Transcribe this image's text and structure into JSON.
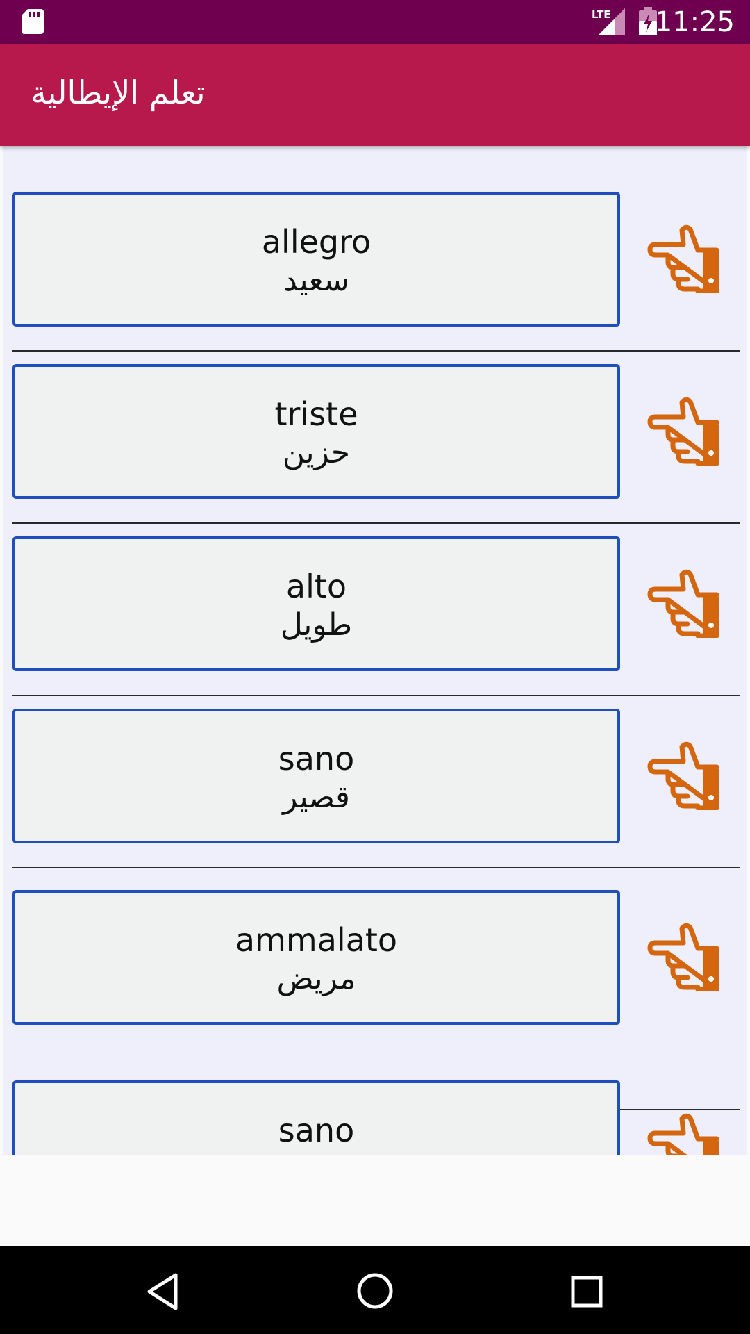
{
  "status_bar": {
    "time": "11:25",
    "network_label": "LTE",
    "icons": [
      "sd-card-icon",
      "lte-signal-icon",
      "battery-charging-icon"
    ]
  },
  "app_bar": {
    "title": "تعلم الإيطالية"
  },
  "words": [
    {
      "italian": "allegro",
      "arabic": "سعيد"
    },
    {
      "italian": "triste",
      "arabic": "حزين"
    },
    {
      "italian": "alto",
      "arabic": "طويل"
    },
    {
      "italian": "sano",
      "arabic": "قصير"
    },
    {
      "italian": "ammalato",
      "arabic": "مريض"
    },
    {
      "italian": "sano",
      "arabic": ""
    }
  ],
  "row_icon": "pointing-hand-icon",
  "nav_bar": {
    "icons": [
      "back-icon",
      "home-icon",
      "recents-icon"
    ]
  },
  "colors": {
    "status_bar": "#6f0050",
    "app_bar": "#b8194c",
    "list_background": "#efeffb",
    "card_border": "#1f4fbf",
    "card_fill": "#f0f1f1",
    "hand_icon": "#d4660f"
  }
}
